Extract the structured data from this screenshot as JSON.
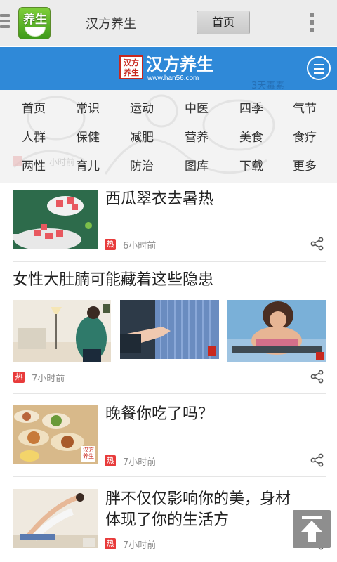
{
  "app_bar": {
    "icon_label": "养生",
    "title": "汉方养生",
    "home_button": "首页"
  },
  "site_header": {
    "seal_line1": "汉方",
    "seal_line2": "养生",
    "logo_text": "汉方养生",
    "logo_url": "www.han56.com",
    "watermark_text": "3天毒素",
    "watermark_time": "小时前"
  },
  "categories": [
    [
      "首页",
      "常识",
      "运动",
      "中医",
      "四季",
      "气节"
    ],
    [
      "人群",
      "保健",
      "减肥",
      "营养",
      "美食",
      "食疗"
    ],
    [
      "两性",
      "育儿",
      "防治",
      "图库",
      "下载",
      "更多"
    ]
  ],
  "articles": [
    {
      "title": "西瓜翠衣去暑热",
      "badge": "热",
      "time": "6小时前"
    },
    {
      "title": "女性大肚腩可能藏着这些隐患",
      "badge": "热",
      "time": "7小时前"
    },
    {
      "title": "晚餐你吃了吗？",
      "badge": "热",
      "time": "7小时前",
      "thumb_stamp": "汉方\n养生"
    },
    {
      "title_line1": "胖不仅仅影响你的美，身材",
      "title_line2": "体现了你的生活方",
      "badge": "热",
      "time": "7小时前"
    }
  ],
  "colors": {
    "header_blue": "#2f89d8",
    "hot_red": "#e83b3b",
    "time_gray": "#8d8d8d"
  }
}
